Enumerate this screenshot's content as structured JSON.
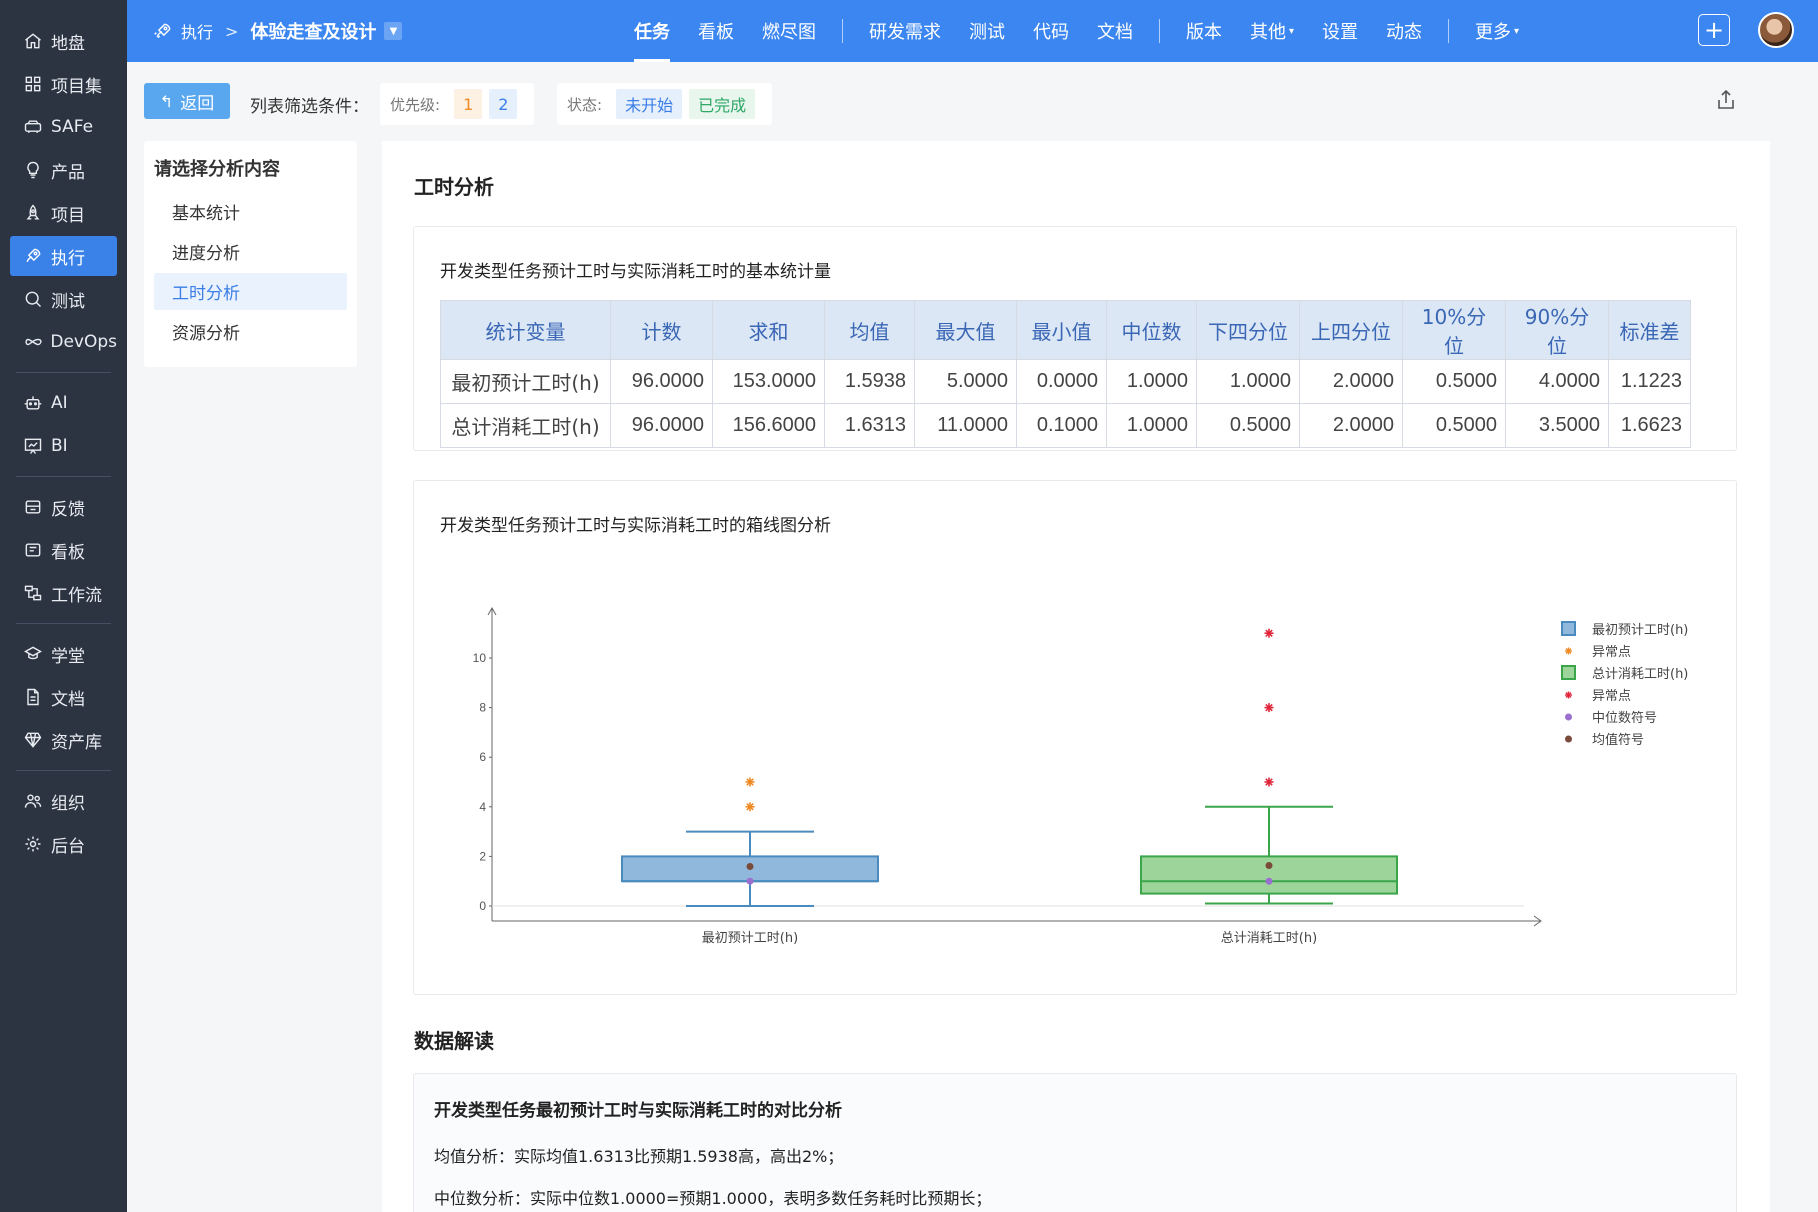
{
  "sidebar": {
    "items": [
      {
        "label": "地盘",
        "icon": "home-icon",
        "group": 1
      },
      {
        "label": "项目集",
        "icon": "grid-icon",
        "group": 1
      },
      {
        "label": "SAFe",
        "icon": "car-icon",
        "group": 1
      },
      {
        "label": "产品",
        "icon": "bulb-icon",
        "group": 1
      },
      {
        "label": "项目",
        "icon": "rocket-icon",
        "group": 1
      },
      {
        "label": "执行",
        "icon": "launch-icon",
        "group": 1,
        "active": true
      },
      {
        "label": "测试",
        "icon": "search-icon",
        "group": 1
      },
      {
        "label": "DevOps",
        "icon": "infinity-icon",
        "group": 1
      },
      {
        "label": "AI",
        "icon": "robot-icon",
        "group": 2
      },
      {
        "label": "BI",
        "icon": "chart-board-icon",
        "group": 2
      },
      {
        "label": "反馈",
        "icon": "feedback-icon",
        "group": 3
      },
      {
        "label": "看板",
        "icon": "kanban-icon",
        "group": 3
      },
      {
        "label": "工作流",
        "icon": "workflow-icon",
        "group": 3
      },
      {
        "label": "学堂",
        "icon": "academy-icon",
        "group": 4
      },
      {
        "label": "文档",
        "icon": "doc-icon",
        "group": 4
      },
      {
        "label": "资产库",
        "icon": "diamond-icon",
        "group": 4
      },
      {
        "label": "组织",
        "icon": "people-icon",
        "group": 5
      },
      {
        "label": "后台",
        "icon": "gear-icon",
        "group": 5
      }
    ],
    "ghost_label": "执行"
  },
  "header": {
    "breadcrumb_parent": "执行",
    "breadcrumb_sep": ">",
    "title": "体验走查及设计",
    "nav": [
      {
        "label": "任务",
        "active": true
      },
      {
        "label": "看板"
      },
      {
        "label": "燃尽图"
      },
      {
        "sep": true
      },
      {
        "label": "研发需求"
      },
      {
        "label": "测试"
      },
      {
        "label": "代码"
      },
      {
        "label": "文档"
      },
      {
        "sep": true
      },
      {
        "label": "版本"
      },
      {
        "label": "其他",
        "caret": true
      },
      {
        "label": "设置"
      },
      {
        "label": "动态"
      },
      {
        "sep": true
      },
      {
        "label": "更多",
        "caret": true
      }
    ],
    "plus": "+"
  },
  "filter": {
    "back_label": "返回",
    "label": "列表筛选条件：",
    "priority_label": "优先级:",
    "priority_values": [
      "1",
      "2"
    ],
    "status_label": "状态:",
    "status_values": [
      "未开始",
      "已完成"
    ]
  },
  "menu": {
    "title": "请选择分析内容",
    "items": [
      "基本统计",
      "进度分析",
      "工时分析",
      "资源分析"
    ],
    "active_index": 2
  },
  "main": {
    "title": "工时分析",
    "stats_card_title": "开发类型任务预计工时与实际消耗工时的基本统计量",
    "stats_table": {
      "headers": [
        "统计变量",
        "计数",
        "求和",
        "均值",
        "最大值",
        "最小值",
        "中位数",
        "下四分位",
        "上四分位",
        "10%分位",
        "90%分位",
        "标准差"
      ],
      "rows": [
        [
          "最初预计工时(h)",
          "96.0000",
          "153.0000",
          "1.5938",
          "5.0000",
          "0.0000",
          "1.0000",
          "1.0000",
          "2.0000",
          "0.5000",
          "4.0000",
          "1.1223"
        ],
        [
          "总计消耗工时(h)",
          "96.0000",
          "156.6000",
          "1.6313",
          "11.0000",
          "0.1000",
          "1.0000",
          "0.5000",
          "2.0000",
          "0.5000",
          "3.5000",
          "1.6623"
        ]
      ]
    },
    "box_card_title": "开发类型任务预计工时与实际消耗工时的箱线图分析",
    "reading_title": "数据解读",
    "reading_subtitle": "开发类型任务最初预计工时与实际消耗工时的对比分析",
    "reading_lines": [
      "均值分析：实际均值1.6313比预期1.5938高，高出2%；",
      "中位数分析：实际中位数1.0000=预期1.0000，表明多数任务耗时比预期长；"
    ]
  },
  "chart_data": {
    "type": "box",
    "title": "",
    "xlabel": "",
    "ylabel": "",
    "ylim": [
      0,
      12
    ],
    "yticks": [
      0,
      2,
      4,
      6,
      8,
      10
    ],
    "grid": false,
    "legend_position": "right",
    "categories": [
      "最初预计工时(h)",
      "总计消耗工时(h)"
    ],
    "series": [
      {
        "name": "最初预计工时(h)",
        "color": "#4a8bbf",
        "fill": "#8fb8dc",
        "whisker_low": 0,
        "q1": 1,
        "median": 1,
        "q3": 2,
        "whisker_high": 3,
        "mean": 1.5938,
        "outliers": [
          4,
          5
        ],
        "outlier_name": "异常点",
        "outlier_color": "#f08a24"
      },
      {
        "name": "总计消耗工时(h)",
        "color": "#3aa54a",
        "fill": "#9dd49a",
        "whisker_low": 0.1,
        "q1": 0.5,
        "median": 1,
        "q3": 2,
        "whisker_high": 4,
        "mean": 1.6313,
        "outliers": [
          5,
          8,
          11
        ],
        "outlier_name": "异常点",
        "outlier_color": "#e0263a"
      }
    ],
    "legend": [
      {
        "label": "最初预计工时(h)",
        "kind": "box",
        "color": "#4a8bbf",
        "fill": "#8fb8dc"
      },
      {
        "label": "异常点",
        "kind": "star",
        "color": "#f08a24"
      },
      {
        "label": "总计消耗工时(h)",
        "kind": "box",
        "color": "#3aa54a",
        "fill": "#9dd49a"
      },
      {
        "label": "异常点",
        "kind": "star",
        "color": "#e0263a"
      },
      {
        "label": "中位数符号",
        "kind": "dot",
        "color": "#9b6fcf"
      },
      {
        "label": "均值符号",
        "kind": "dot",
        "color": "#7a4a3a"
      }
    ]
  }
}
